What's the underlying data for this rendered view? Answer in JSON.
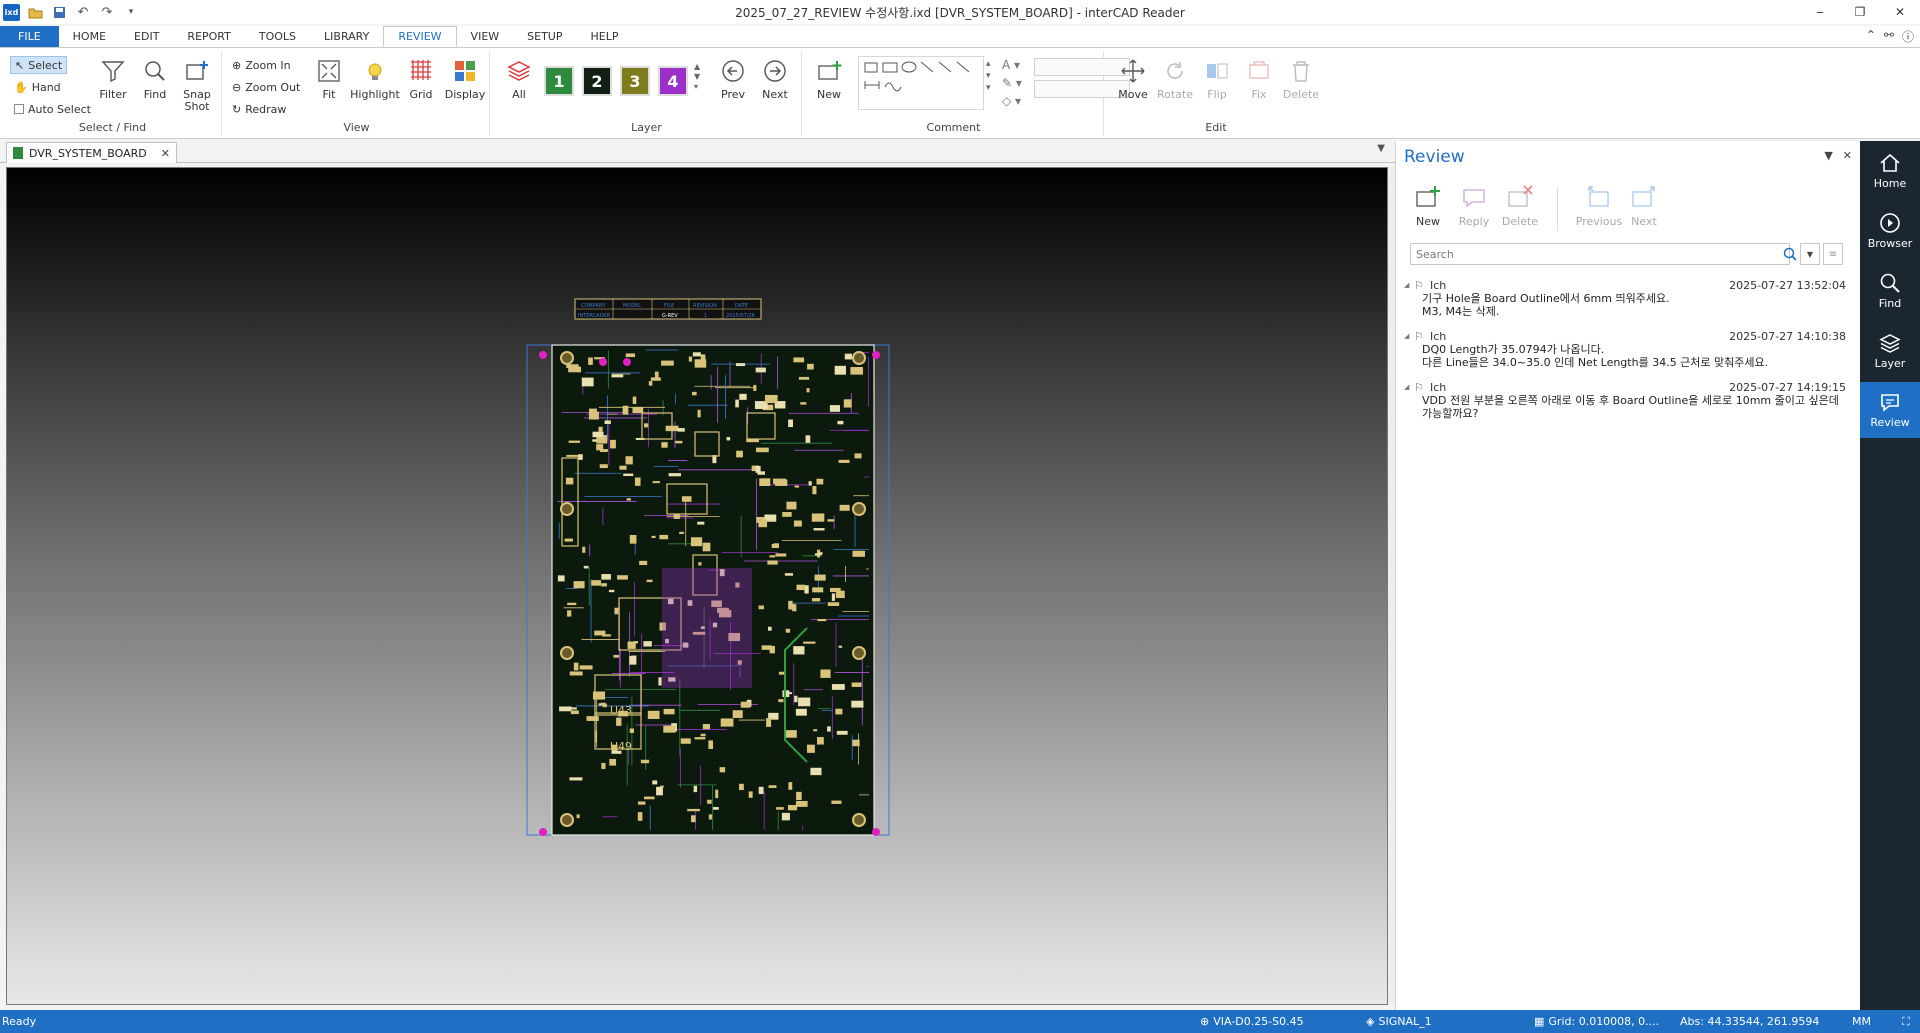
{
  "window": {
    "title": "2025_07_27_REVIEW 수정사항.ixd [DVR_SYSTEM_BOARD] - interCAD Reader",
    "app_logo_text": "ixd"
  },
  "menu": {
    "tabs": [
      "FILE",
      "HOME",
      "EDIT",
      "REPORT",
      "TOOLS",
      "LIBRARY",
      "REVIEW",
      "VIEW",
      "SETUP",
      "HELP"
    ],
    "active": "REVIEW"
  },
  "ribbon": {
    "select_find": {
      "label": "Select / Find",
      "select": "Select",
      "hand": "Hand",
      "auto_select": "Auto Select",
      "filter": "Filter",
      "find": "Find",
      "snap_shot": "Snap Shot"
    },
    "view": {
      "label": "View",
      "zoom_in": "Zoom In",
      "zoom_out": "Zoom Out",
      "redraw": "Redraw",
      "fit": "Fit",
      "highlight": "Highlight",
      "grid": "Grid",
      "display": "Display"
    },
    "layer": {
      "label": "Layer",
      "all": "All",
      "layers": [
        {
          "num": "1",
          "color": "#2e8b3e"
        },
        {
          "num": "2",
          "color": "#111f14"
        },
        {
          "num": "3",
          "color": "#7d7d1c"
        },
        {
          "num": "4",
          "color": "#9b30c8"
        }
      ],
      "prev": "Prev",
      "next": "Next"
    },
    "new_label": "New",
    "comment_label": "Comment",
    "edit": {
      "label": "Edit",
      "move": "Move",
      "rotate": "Rotate",
      "flip": "Flip",
      "fix": "Fix",
      "delete": "Delete"
    }
  },
  "document_tab": "DVR_SYSTEM_BOARD",
  "board": {
    "title_block": [
      "COMPANY",
      "MODEL",
      "FILE",
      "REVISION",
      "DATE"
    ],
    "title_values": [
      "INTERCADKR",
      "",
      "G-REV",
      "1",
      "2025/07/26"
    ],
    "labels": [
      "U43",
      "U49"
    ]
  },
  "review": {
    "title": "Review",
    "tools": {
      "new": "New",
      "reply": "Reply",
      "delete": "Delete",
      "previous": "Previous",
      "next": "Next"
    },
    "search_placeholder": "Search",
    "comments": [
      {
        "author": "Ich",
        "time": "2025-07-27 13:52:04",
        "lines": [
          "기구 Hole을 Board Outline에서 6mm 띄워주세요.",
          "M3, M4는 삭제."
        ]
      },
      {
        "author": "Ich",
        "time": "2025-07-27 14:10:38",
        "lines": [
          "DQ0 Length가 35.0794가 나옵니다.",
          "다른 Line들은 34.0~35.0 인데 Net Length를 34.5 근처로 맞춰주세요."
        ]
      },
      {
        "author": "Ich",
        "time": "2025-07-27 14:19:15",
        "lines": [
          "VDD 전원 부분을 오른쪽 아래로 이동 후 Board Outline을 세로로 10mm 줄이고 싶은데",
          "가능할까요?"
        ]
      }
    ]
  },
  "right_nav": [
    "Home",
    "Browser",
    "Find",
    "Layer",
    "Review"
  ],
  "right_nav_active": "Review",
  "status": {
    "ready": "Ready",
    "via": "VIA-D0.25-S0.45",
    "signal": "SIGNAL_1",
    "grid": "Grid: 0.010008, 0....",
    "abs": "Abs: 44.33544, 261.9594",
    "unit": "MM"
  }
}
